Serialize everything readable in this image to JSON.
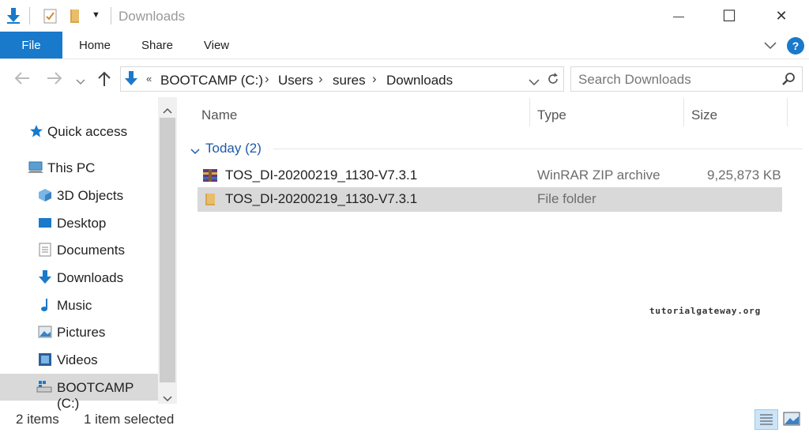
{
  "window": {
    "title": "Downloads",
    "controls": {
      "minimize": "—",
      "maximize": "☐",
      "close": "✕"
    }
  },
  "ribbon": {
    "tabs": [
      {
        "label": "File",
        "active": true
      },
      {
        "label": "Home"
      },
      {
        "label": "Share"
      },
      {
        "label": "View"
      }
    ],
    "help": "?"
  },
  "address": {
    "overflow": "«",
    "crumbs": [
      "BOOTCAMP (C:)",
      "Users",
      "sures",
      "Downloads"
    ]
  },
  "search": {
    "placeholder": "Search Downloads"
  },
  "nav": {
    "quick_access": "Quick access",
    "this_pc": "This PC",
    "items": [
      {
        "label": "3D Objects",
        "icon": "3d-objects-icon"
      },
      {
        "label": "Desktop",
        "icon": "desktop-icon"
      },
      {
        "label": "Documents",
        "icon": "documents-icon"
      },
      {
        "label": "Downloads",
        "icon": "downloads-icon"
      },
      {
        "label": "Music",
        "icon": "music-icon"
      },
      {
        "label": "Pictures",
        "icon": "pictures-icon"
      },
      {
        "label": "Videos",
        "icon": "videos-icon"
      },
      {
        "label": "BOOTCAMP (C:)",
        "icon": "drive-icon",
        "selected": true
      }
    ]
  },
  "columns": {
    "name": "Name",
    "type": "Type",
    "size": "Size"
  },
  "group": {
    "label": "Today (2)"
  },
  "files": [
    {
      "name": "TOS_DI-20200219_1130-V7.3.1",
      "type": "WinRAR ZIP archive",
      "size": "9,25,873 KB",
      "icon": "winrar-archive-icon"
    },
    {
      "name": "TOS_DI-20200219_1130-V7.3.1",
      "type": "File folder",
      "size": "",
      "icon": "folder-icon",
      "selected": true
    }
  ],
  "watermark": "tutorialgateway.org",
  "status": {
    "count": "2 items",
    "selection": "1 item selected"
  },
  "colors": {
    "accent": "#1979ca",
    "selection": "#d9d9d9",
    "group_header": "#1e5aa8"
  }
}
